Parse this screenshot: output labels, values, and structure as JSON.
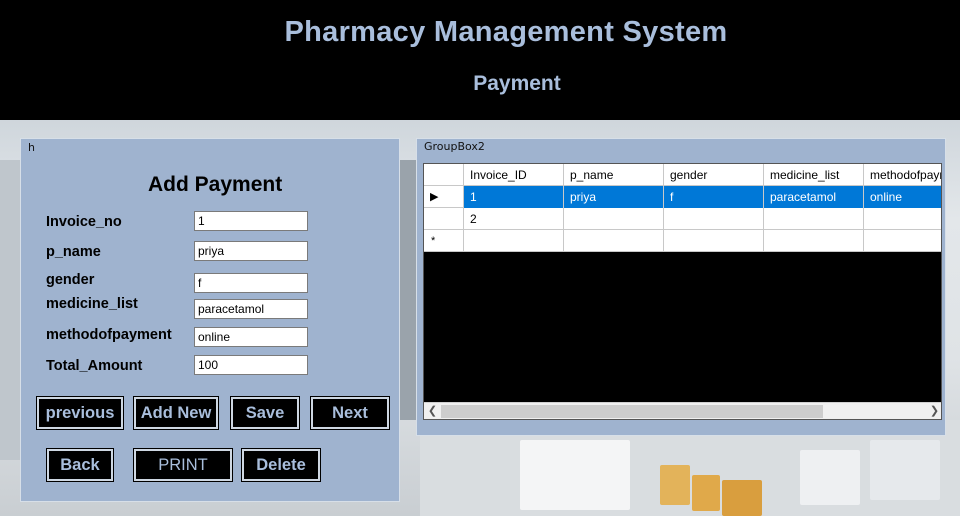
{
  "header": {
    "title": "Pharmacy Management System",
    "subtitle": "Payment"
  },
  "form_group": {
    "caption": "h",
    "title": "Add Payment",
    "fields": [
      {
        "label": "Invoice_no",
        "value": "1"
      },
      {
        "label": "p_name",
        "value": "priya"
      },
      {
        "label": "gender",
        "value": "f"
      },
      {
        "label": "medicine_list",
        "value": "paracetamol"
      },
      {
        "label": "methodofpayment",
        "value": "online"
      },
      {
        "label": "Total_Amount",
        "value": "100"
      }
    ],
    "buttons": {
      "previous": "previous",
      "add_new": "Add New",
      "save": "Save",
      "next": "Next",
      "back": "Back",
      "print": "PRINT",
      "delete": "Delete"
    }
  },
  "grid_group": {
    "caption": "GroupBox2",
    "columns": [
      "Invoice_ID",
      "p_name",
      "gender",
      "medicine_list",
      "methodofpaym"
    ],
    "rows": [
      [
        "1",
        "priya",
        "f",
        "paracetamol",
        "online"
      ],
      [
        "2",
        "",
        "",
        "",
        ""
      ]
    ],
    "selected_row": 0,
    "new_row_marker": "*",
    "current_row_marker": "▶"
  },
  "colors": {
    "header_bg": "#000000",
    "title_text": "#a9bedc",
    "panel_bg": "#9fb3cf",
    "button_bg": "#000000",
    "selection": "#0078d7"
  }
}
